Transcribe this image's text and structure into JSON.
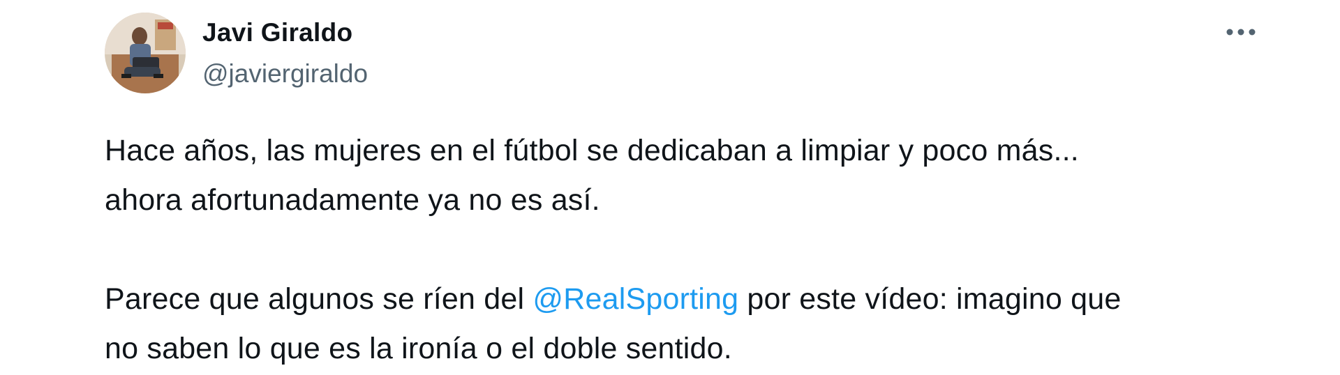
{
  "author": {
    "display_name": "Javi Giraldo",
    "handle": "@javiergiraldo"
  },
  "more_icon": "more-horizontal-icon",
  "tweet": {
    "paragraph1_line1": "Hace años, las mujeres en el fútbol se dedicaban a limpiar y poco más...",
    "paragraph1_line2": "ahora afortunadamente ya no es así.",
    "paragraph2_before_mention": "Parece que algunos se ríen del ",
    "mention": "@RealSporting",
    "paragraph2_after_mention": " por este vídeo: imagino que",
    "paragraph2_line2": "no saben lo que es la ironía o el doble sentido."
  },
  "colors": {
    "text": "#0f1419",
    "secondary_text": "#536471",
    "link": "#1d9bf0",
    "background": "#ffffff"
  }
}
